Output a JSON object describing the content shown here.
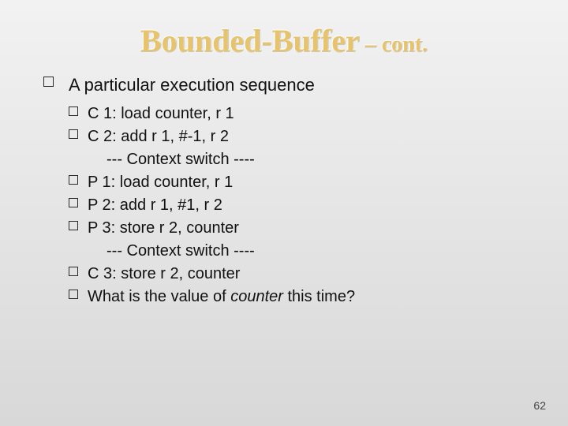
{
  "title": {
    "main": "Bounded-Buffer",
    "sub": " – cont."
  },
  "outline": {
    "lvl1": "A particular execution sequence",
    "items": {
      "c1": "C 1: load counter, r 1",
      "c2": "C 2: add r 1, #-1, r 2",
      "sw1": "--- Context switch ----",
      "p1": "P 1:  load counter, r 1",
      "p2": "P 2:  add  r 1, #1, r 2",
      "p3": "P 3:  store r 2, counter",
      "sw2": "--- Context switch ----",
      "c3": "C 3: store r 2, counter",
      "q_pre": "What is the value of ",
      "q_em": "counter",
      "q_post": " this time?"
    }
  },
  "page": "62"
}
